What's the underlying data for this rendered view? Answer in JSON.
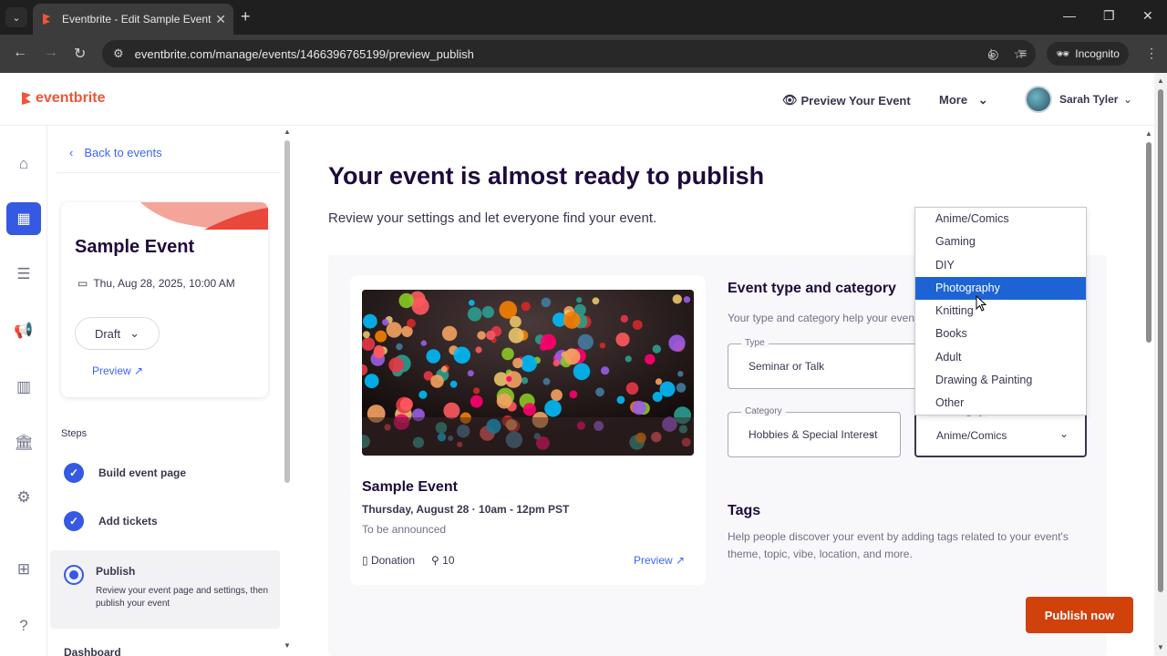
{
  "browser": {
    "tab_title": "Eventbrite - Edit Sample Event",
    "url": "eventbrite.com/manage/events/1466396765199/preview_publish",
    "incognito_label": "Incognito"
  },
  "topnav": {
    "logo": "eventbrite",
    "preview_event": "Preview Your Event",
    "more": "More",
    "user_name": "Sarah Tyler"
  },
  "sidebar": {
    "back": "Back to events",
    "event_title": "Sample Event",
    "event_date": "Thu, Aug 28, 2025, 10:00 AM",
    "status": "Draft",
    "preview": "Preview",
    "steps_heading": "Steps",
    "steps": [
      {
        "label": "Build event page"
      },
      {
        "label": "Add tickets"
      },
      {
        "label": "Publish",
        "desc": "Review your event page and settings, then publish your event"
      }
    ],
    "dashboard": "Dashboard"
  },
  "main": {
    "title": "Your event is almost ready to publish",
    "subtitle": "Review your settings and let everyone find your event.",
    "card": {
      "title": "Sample Event",
      "date": "Thursday, August 28 · 10am - 12pm PST",
      "location": "To be announced",
      "donation": "Donation",
      "capacity": "10",
      "preview": "Preview"
    },
    "type_section": {
      "title": "Event type and category",
      "desc": "Your type and category help your event appear in more searches.",
      "type_label": "Type",
      "type_value": "Seminar or Talk",
      "category_label": "Category",
      "category_value": "Hobbies & Special Interest",
      "subcategory_label": "Subcategory",
      "subcategory_value": "Anime/Comics"
    },
    "tags": {
      "title": "Tags",
      "desc": "Help people discover your event by adding tags related to your event's theme, topic, vibe, location, and more."
    },
    "subcategory_options": [
      "Anime/Comics",
      "Gaming",
      "DIY",
      "Photography",
      "Knitting",
      "Books",
      "Adult",
      "Drawing & Painting",
      "Other"
    ],
    "highlighted_option": "Photography",
    "publish_button": "Publish now"
  },
  "colors": {
    "brand": "#f05537",
    "accent": "#3659e3",
    "publish": "#d1410c",
    "selection": "#1e63d6"
  }
}
